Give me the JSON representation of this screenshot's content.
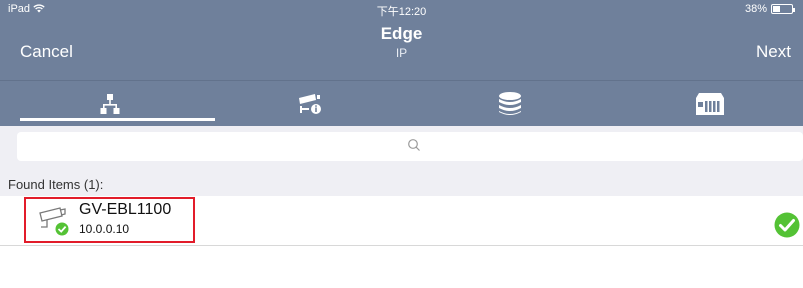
{
  "status_bar": {
    "device": "iPad",
    "time": "下午12:20",
    "battery": "38%",
    "battery_level": 0.38
  },
  "nav": {
    "cancel_label": "Cancel",
    "title": "Edge",
    "subtitle": "IP",
    "next_label": "Next"
  },
  "tabs": [
    {
      "icon": "network-icon",
      "active": true
    },
    {
      "icon": "camera-info-icon",
      "active": false
    },
    {
      "icon": "database-icon",
      "active": false
    },
    {
      "icon": "nvr-device-icon",
      "active": false
    }
  ],
  "search": {
    "placeholder": ""
  },
  "section": {
    "label": "Found Items (1):"
  },
  "items": [
    {
      "name": "GV-EBL1100",
      "ip": "10.0.0.10",
      "selected": true
    }
  ],
  "colors": {
    "header": "#6f809b",
    "highlight": "#e21c2a",
    "check": "#54c235"
  }
}
